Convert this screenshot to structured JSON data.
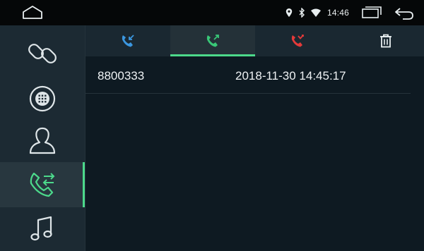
{
  "status": {
    "time": "14:46",
    "icons": [
      "location-icon",
      "bluetooth-icon",
      "wifi-icon"
    ]
  },
  "nav": {
    "home": "home-icon",
    "recents": "recent-apps-icon",
    "back": "back-icon"
  },
  "sidebar": {
    "items": [
      {
        "name": "link-icon",
        "active": false
      },
      {
        "name": "dialpad-icon",
        "active": false
      },
      {
        "name": "contacts-icon",
        "active": false
      },
      {
        "name": "call-log-icon",
        "active": true
      },
      {
        "name": "music-icon",
        "active": false
      }
    ]
  },
  "tabs": [
    {
      "name": "incoming-calls-icon",
      "color": "#3b97e0",
      "active": false
    },
    {
      "name": "outgoing-calls-icon",
      "color": "#39c777",
      "active": true
    },
    {
      "name": "missed-calls-icon",
      "color": "#e33a3a",
      "active": false
    }
  ],
  "accent": "#4cd98b",
  "calls": [
    {
      "number": "8800333",
      "time": "2018-11-30 14:45:17"
    }
  ]
}
